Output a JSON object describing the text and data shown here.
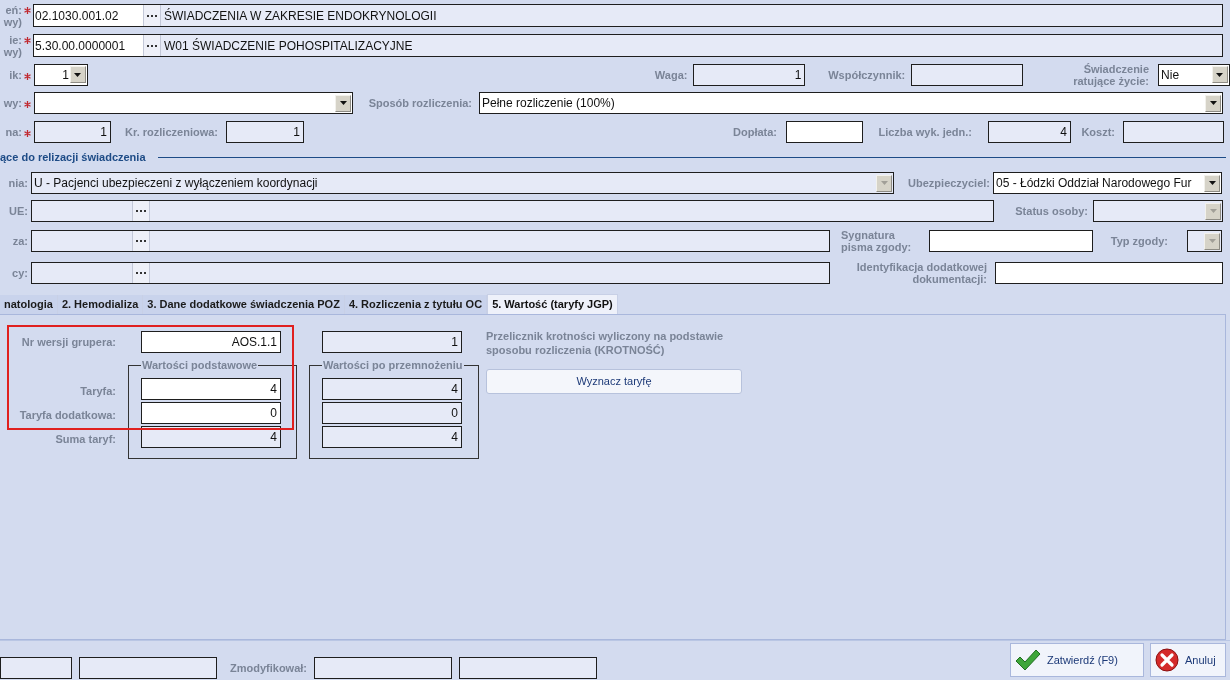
{
  "service": {
    "label_lines": [
      "eń:",
      "wy)"
    ],
    "required": true,
    "code": "02.1030.001.02",
    "name": "ŚWIADCZENIA W ZAKRESIE ENDOKRYNOLOGII"
  },
  "procedure": {
    "label_lines": [
      "ie:",
      "wy)"
    ],
    "required": true,
    "code": "5.30.00.0000001",
    "name": "W01 ŚWIADCZENIE POHOSPITALIZACYJNE"
  },
  "counter": {
    "label": "ik:",
    "required": true,
    "value": "1",
    "disabled": false
  },
  "weight": {
    "label": "Waga:",
    "value": "1",
    "disabled": true
  },
  "coefficient": {
    "label": "Współczynnik:",
    "disabled": true
  },
  "lifesaving": {
    "label_lines": [
      "Świadczenie",
      "ratujące życie:"
    ],
    "value": "Nie",
    "disabled": false
  },
  "type": {
    "label": "wy:",
    "required": true,
    "disabled": false
  },
  "settlement_method": {
    "label": "Sposób rozliczenia:",
    "value": "Pełne rozliczenie (100%)",
    "disabled": false
  },
  "quantity": {
    "label": "na:",
    "required": true,
    "value": "1",
    "disabled": true
  },
  "settlement_multiplier": {
    "label": "Kr. rozliczeniowa:",
    "value": "1",
    "disabled": true
  },
  "surcharge": {
    "label": "Dopłata:",
    "disabled": false
  },
  "units": {
    "label": "Liczba wyk. jedn.:",
    "value": "4",
    "disabled": true
  },
  "cost": {
    "label": "Koszt:",
    "disabled": true
  },
  "section_title": "ące do relizacji świadczenia",
  "entitlement": {
    "label": "nia:",
    "value": "U - Pacjenci ubezpieczeni z wyłączeniem koordynacji",
    "disabled": true
  },
  "insurer": {
    "label": "Ubezpieczyciel:",
    "value": "05 - Łódzki Oddział Narodowego Fur",
    "disabled": false
  },
  "eu_document": {
    "label": "UE:",
    "disabled": true
  },
  "person_status": {
    "label": "Status osoby:",
    "disabled": true
  },
  "consent_basis": {
    "label": "za:",
    "disabled": true
  },
  "consent_signature": {
    "label_lines": [
      "Sygnatura",
      "pisma zgody:"
    ],
    "disabled": false
  },
  "consent_type": {
    "label": "Typ zgody:",
    "disabled": true
  },
  "other_document": {
    "label": "cy:",
    "disabled": true
  },
  "additional_doc_id": {
    "label_lines": [
      "Identyfikacja dodatkowej",
      "dokumentacji:"
    ],
    "disabled": false
  },
  "tabs": [
    {
      "label": "natologia",
      "selected": false
    },
    {
      "label": "2. Hemodializa",
      "selected": false
    },
    {
      "label": "3. Dane dodatkowe świadczenia POZ",
      "selected": false
    },
    {
      "label": "4. Rozliczenia z tytułu OC",
      "selected": false
    },
    {
      "label": "5. Wartość (taryfy JGP)",
      "selected": true
    }
  ],
  "grouper": {
    "label": "Nr wersji grupera:",
    "value": "AOS.1.1",
    "multiplier": "1"
  },
  "groups": [
    "Wartości podstawowe",
    "Wartości po przemnożeniu"
  ],
  "value_rows": [
    {
      "label": "Taryfa:",
      "base": "4",
      "base_disabled": false,
      "multiplied": "4"
    },
    {
      "label": "Taryfa dodatkowa:",
      "base": "0",
      "base_disabled": false,
      "multiplied": "0"
    },
    {
      "label": "Suma taryf:",
      "base": "4",
      "base_disabled": true,
      "multiplied": "4"
    }
  ],
  "note": "Przelicznik krotności wyliczony na podstawie sposobu rozliczenia (KROTNOŚĆ)",
  "compute_button": "Wyznacz taryfę",
  "footer": {
    "modified_label": "Zmodyfikował:"
  },
  "buttons": [
    {
      "label": "Zatwierdź (F9)",
      "kind": "confirm"
    },
    {
      "label": "Anuluj",
      "kind": "cancel"
    }
  ]
}
